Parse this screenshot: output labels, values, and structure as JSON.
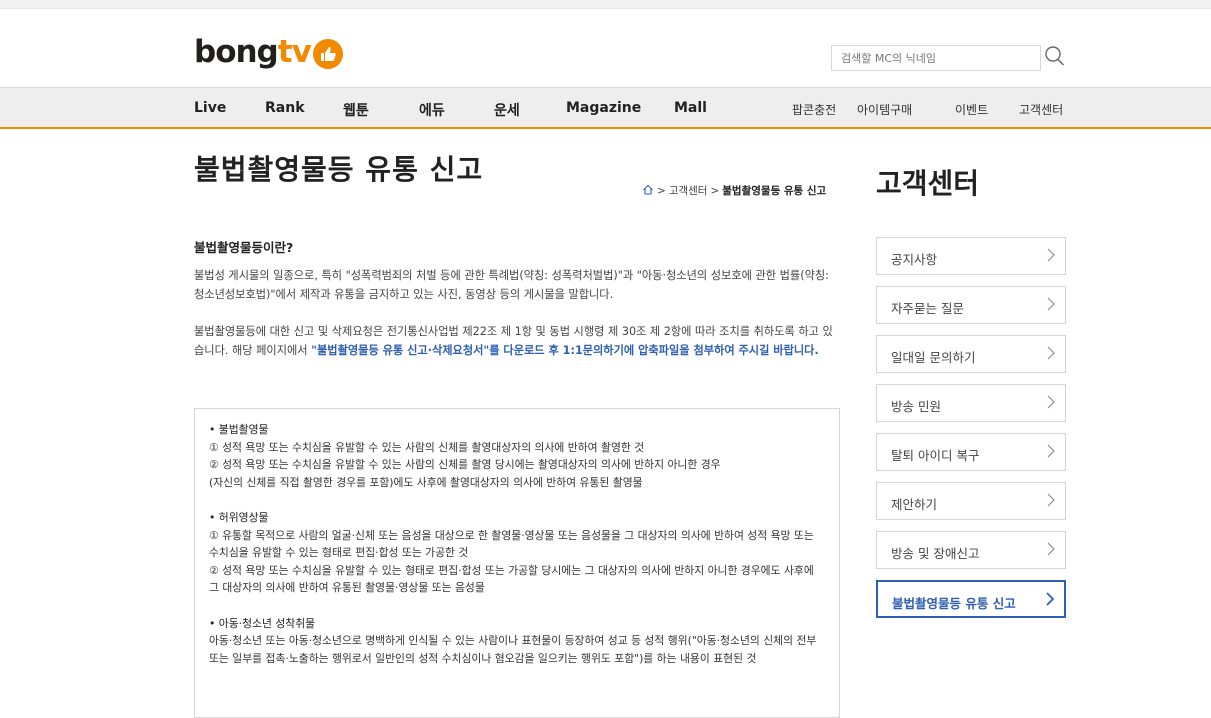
{
  "header": {
    "logo_alt": "bongtv",
    "search_placeholder": "검색할 MC의 닉네임"
  },
  "nav": {
    "items": [
      "Live",
      "Rank",
      "웹툰",
      "에듀",
      "운세",
      "Magazine",
      "Mall"
    ],
    "util": [
      "팝콘충전",
      "아이템구매",
      "이벤트",
      "고객센터"
    ]
  },
  "page": {
    "title": "불법촬영물등 유통 신고",
    "breadcrumb": [
      "고객센터",
      "불법촬영물등 유통 신고"
    ]
  },
  "content": {
    "heading": "불법촬영물등이란?",
    "p1": "불법성 게시물의 일종으로, 특히 \"성폭력범죄의 처벌 등에 관한 특례법(약칭: 성폭력처벌법)\"과 \"아동·청소년의 성보호에 관한 법률(약칭: 청소년성보호법)\"에서 제작과 유통을 금지하고 있는 사진, 동영상 등의 게시물을 말합니다.",
    "p2_a": "불법촬영물등에 대한 신고 및 삭제요청은 전기통신사업법 제22조 제 1항 및 동법 시행령 제 30조 제 2항에 따라 조치를 취하도록 하고 있습니다. 해당 페이지에서 ",
    "p2_b": "\"불법촬영물등 유통 신고·삭제요청서\"를 다운로드 후 1:1문의하기에 압축파일을 첨부하여 주시길 바랍니다.",
    "box": {
      "s1_head": "• 불법촬영물",
      "s1_l1": "① 성적 욕망 또는 수치심을 유발할 수 있는 사람의 신체를 촬영대상자의 의사에 반하여 촬영한 것",
      "s1_l2": "② 성적 욕망 또는 수치심을 유발할 수 있는 사람의 신체를 촬영 당시에는 촬영대상자의 의사에 반하지 아니한 경우",
      "s1_l3": "(자신의 신체를 직접 촬영한 경우를 포함)에도 사후에 촬영대상자의 의사에 반하여 유통된 촬영물",
      "s2_head": "• 허위영상물",
      "s2_l1": "① 유통할 목적으로 사람의 얼굴·신체 또는 음성을 대상으로 한 촬영물·영상물 또는 음성물을 그 대상자의 의사에 반하여 성적 욕망 또는 수치심을 유발할 수 있는 형태로 편집·합성 또는 가공한 것",
      "s2_l2": "② 성적 욕망 또는 수치심을 유발할 수 있는 형태로 편집·합성 또는 가공할 당시에는 그 대상자의 의사에 반하지 아니한 경우에도 사후에 그 대상자의 의사에 반하여 유통된 촬영물·영상물 또는 음성물",
      "s3_head": "• 아동·청소년 성착취물",
      "s3_l1": "아동·청소년 또는 아동·청소년으로 명백하게 인식될 수 있는 사람이나 표현물이 등장하여 성교 등 성적 행위(\"아동·청소년의 신체의 전부 또는 일부를 접촉·노출하는 행위로서 일반인의 성적 수치심이나 혐오감을 일으키는 행위도 포함\")를 하는 내용이 표현된 것"
    }
  },
  "sidebar": {
    "title": "고객센터",
    "items": [
      "공지사항",
      "자주묻는 질문",
      "일대일 문의하기",
      "방송 민원",
      "탈퇴 아이디 복구",
      "제안하기",
      "방송 및 장애신고",
      "불법촬영물등 유통 신고"
    ],
    "active_index": 7
  },
  "colors": {
    "accent": "#f28a00",
    "link": "#2e5fb0"
  }
}
